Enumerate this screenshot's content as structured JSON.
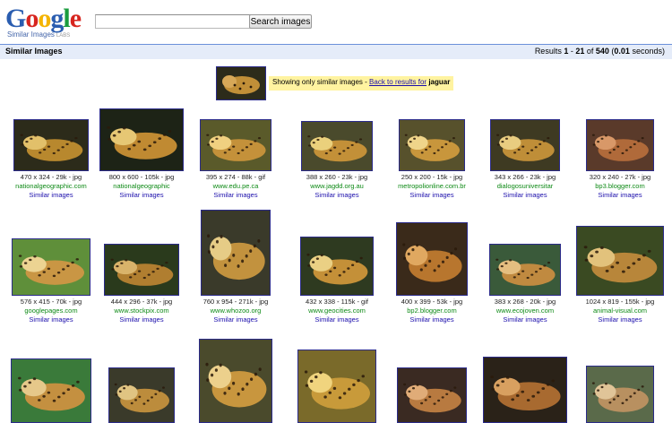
{
  "header": {
    "logo_text": "Google",
    "logo_sub": "Similar Images",
    "logo_labs": "LABS",
    "search_value": "",
    "search_button": "Search images"
  },
  "bar": {
    "title": "Similar Images",
    "results_prefix": "Results",
    "range_start": "1",
    "range_end": "21",
    "total": "540",
    "time": "0.01",
    "seconds_label": "seconds"
  },
  "notice": {
    "text": "Showing only similar images - ",
    "link": "Back to results for",
    "query": "jaguar"
  },
  "results": [
    {
      "meta": "470 x 324 - 29k - jpg",
      "domain": "nationalgeographic.com",
      "similar": "Similar images",
      "palette": [
        "#2c2b1a",
        "#b8882e",
        "#e2c06a"
      ]
    },
    {
      "meta": "800 x 600 - 105k - jpg",
      "domain": "nationalgeographic",
      "similar": "Similar images",
      "palette": [
        "#1d2316",
        "#c08a32",
        "#e6c774"
      ]
    },
    {
      "meta": "395 x 274 - 88k - gif",
      "domain": "www.edu.pe.ca",
      "similar": "Similar images",
      "palette": [
        "#5a5a2a",
        "#c4913a",
        "#f0d080"
      ]
    },
    {
      "meta": "388 x 260 - 23k - jpg",
      "domain": "www.jagdd.org.au",
      "similar": "Similar images",
      "palette": [
        "#4a4a2c",
        "#c39038",
        "#ead07c"
      ]
    },
    {
      "meta": "250 x 200 - 15k - jpg",
      "domain": "metropolionline.com.br",
      "similar": "Similar images",
      "palette": [
        "#57512c",
        "#c8963c",
        "#efd48a"
      ]
    },
    {
      "meta": "343 x 266 - 23k - jpg",
      "domain": "dialogosuniversitar",
      "similar": "Similar images",
      "palette": [
        "#3e3a22",
        "#bf8e38",
        "#e8cc80"
      ]
    },
    {
      "meta": "320 x 240 - 27k - jpg",
      "domain": "bp3.blogger.com",
      "similar": "Similar images",
      "palette": [
        "#5a3a2a",
        "#b06a3a",
        "#d89868"
      ]
    },
    {
      "meta": "576 x 415 - 70k - jpg",
      "domain": "googlepages.com",
      "similar": "Similar images",
      "palette": [
        "#5f8f3a",
        "#c99644",
        "#ecd392"
      ]
    },
    {
      "meta": "444 x 296 - 37k - jpg",
      "domain": "www.stockpix.com",
      "similar": "Similar images",
      "palette": [
        "#2a3a1c",
        "#b07e30",
        "#d9b36a"
      ]
    },
    {
      "meta": "760 x 954 - 271k - jpg",
      "domain": "www.whozoo.org",
      "similar": "Similar images",
      "palette": [
        "#3a3a2a",
        "#c2923e",
        "#e6cc86"
      ]
    },
    {
      "meta": "432 x 338 - 115k - gif",
      "domain": "www.geocities.com",
      "similar": "Similar images",
      "palette": [
        "#2e3a20",
        "#c49038",
        "#ead084"
      ]
    },
    {
      "meta": "400 x 399 - 53k - jpg",
      "domain": "bp2.blogger.com",
      "similar": "Similar images",
      "palette": [
        "#3a2a1a",
        "#b8762e",
        "#e0a860"
      ]
    },
    {
      "meta": "383 x 268 - 20k - jpg",
      "domain": "www.ecojoven.com",
      "similar": "Similar images",
      "palette": [
        "#3a5a3a",
        "#c08a40",
        "#e4be80"
      ]
    },
    {
      "meta": "1024 x 819 - 155k - jpg",
      "domain": "animal-visual.com",
      "similar": "Similar images",
      "palette": [
        "#3a4a22",
        "#b8863a",
        "#e2c27c"
      ]
    },
    {
      "meta": "",
      "domain": "",
      "similar": "",
      "palette": [
        "#3a7a3a",
        "#c49040",
        "#e6c88a"
      ]
    },
    {
      "meta": "",
      "domain": "",
      "similar": "",
      "palette": [
        "#3a3a2a",
        "#bc8c3c",
        "#e0c482"
      ]
    },
    {
      "meta": "",
      "domain": "",
      "similar": "",
      "palette": [
        "#4a4a2c",
        "#c8963e",
        "#ecd08c"
      ]
    },
    {
      "meta": "",
      "domain": "",
      "similar": "",
      "palette": [
        "#7a6a2a",
        "#c89a3a",
        "#f0d47e"
      ]
    },
    {
      "meta": "",
      "domain": "",
      "similar": "",
      "palette": [
        "#3a2a22",
        "#b87a40",
        "#e0ac78"
      ]
    },
    {
      "meta": "",
      "domain": "",
      "similar": "",
      "palette": [
        "#2a2218",
        "#a86a30",
        "#d8a060"
      ]
    },
    {
      "meta": "",
      "domain": "",
      "similar": "",
      "palette": [
        "#5a6a4a",
        "#b89060",
        "#e0c498"
      ]
    }
  ]
}
